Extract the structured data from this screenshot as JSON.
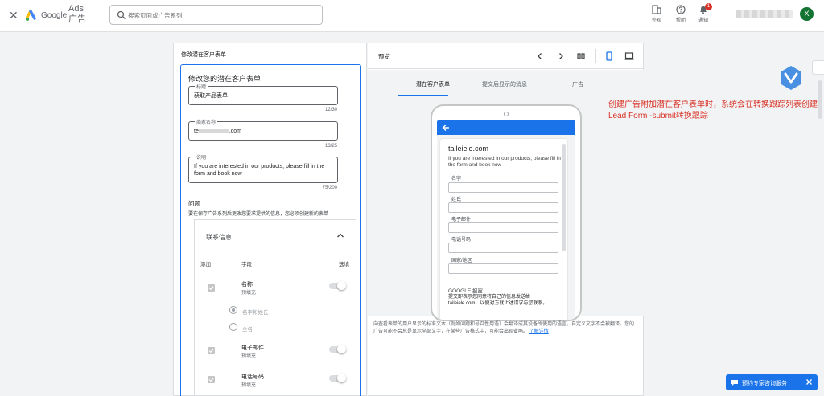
{
  "topbar": {
    "brand_google": "Google",
    "brand_ads": "Ads 广告",
    "search_placeholder": "搜索页面或广告系列",
    "appearance_label": "外观",
    "help_label": "帮助",
    "notifications_label": "通知",
    "notifications_count": "1",
    "avatar_initial": "X"
  },
  "editor": {
    "panel_title": "修改潜在客户表单",
    "form_heading": "修改您的潜在客户表单",
    "headline": {
      "label": "标题",
      "value": "获取产品表单",
      "counter": "12/30"
    },
    "business": {
      "label": "商家名称",
      "value_start": "te",
      "value_end": ".com",
      "counter": "13/25"
    },
    "description": {
      "label": "说明",
      "value": "If you are interested in our products, please fill in the form and book now",
      "counter": "75/200"
    },
    "questions_title": "问题",
    "questions_desc": "要在保存广告系列后更改您要求提供的信息，您必须创建新的表单",
    "contact": {
      "title": "联系信息",
      "col_add": "添加",
      "col_field": "字段",
      "col_optional": "选填",
      "name_label": "名称",
      "name_sub": "预填充",
      "radio_first_last": "名字和姓氏",
      "radio_full": "全名",
      "email_label": "电子邮件",
      "email_sub": "预填充",
      "phone_label": "电话号码",
      "phone_sub": "预填充"
    }
  },
  "preview": {
    "title": "预览",
    "tabs": [
      "潜在客户表单",
      "提交后显示的消息",
      "广告"
    ],
    "phone": {
      "domain": "taileiele.com",
      "desc": "If you are interested in our products, please fill in the form and book now",
      "fields": [
        "名字",
        "姓氏",
        "电子邮件",
        "电话号码",
        "国家/地区"
      ],
      "google_privacy": "GOOGLE 披露",
      "note": "提交即表示您同意将自己的信息发送给 taileiele.com，以便对方就上述请求与您联系。"
    },
    "footer_text": "向查看表单的用户显示的标准文本（例如问题和号召性用语）会翻译成其设备所使用的语言。自定义文字不会被翻译。您的广告可能不会总是显示全部文字，在某些广告格式中，可能会出现省略。",
    "footer_link": "了解详情"
  },
  "annotation": "创建广告附加潜在客户表单时，系统会在转换跟踪列表创建Lead Form -submit转换跟踪",
  "consult_label": "预约专家咨询服务",
  "colors": {
    "accent": "#1a73e8",
    "annotation": "#d93025",
    "avatar": "#137333"
  }
}
